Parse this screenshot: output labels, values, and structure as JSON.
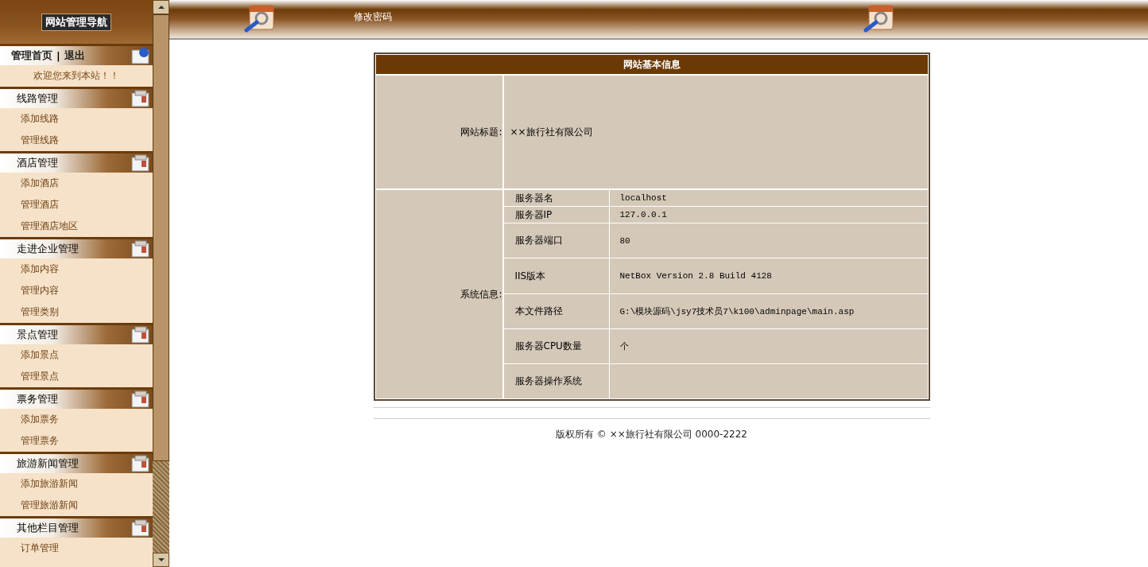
{
  "sidebar": {
    "title": "网站管理导航",
    "top_links": [
      "管理首页",
      "退出"
    ],
    "top_separator": "|",
    "welcome": "欢迎您来到本站！！",
    "sections": [
      {
        "title": "线路管理",
        "items": [
          "添加线路",
          "管理线路"
        ]
      },
      {
        "title": "酒店管理",
        "items": [
          "添加酒店",
          "管理酒店",
          "管理酒店地区"
        ]
      },
      {
        "title": "走进企业管理",
        "items": [
          "添加内容",
          "管理内容",
          "管理类别"
        ]
      },
      {
        "title": "景点管理",
        "items": [
          "添加景点",
          "管理景点"
        ]
      },
      {
        "title": "票务管理",
        "items": [
          "添加票务",
          "管理票务"
        ]
      },
      {
        "title": "旅游新闻管理",
        "items": [
          "添加旅游新闻",
          "管理旅游新闻"
        ]
      },
      {
        "title": "其他栏目管理",
        "items": [
          "订单管理"
        ]
      }
    ]
  },
  "top_bar": {
    "link": "修改密码"
  },
  "info_panel": {
    "title": "网站基本信息",
    "site_title": {
      "label": "网站标题:",
      "value": "××旅行社有限公司"
    },
    "system_info": {
      "label": "系统信息:",
      "rows": [
        {
          "name": "服务器名",
          "value": "localhost"
        },
        {
          "name": "服务器IP",
          "value": "127.0.0.1"
        },
        {
          "name": "服务器端口",
          "value": "80"
        },
        {
          "name": "IIS版本",
          "value": "NetBox Version 2.8 Build 4128"
        },
        {
          "name": "本文件路径",
          "value": "G:\\模块源码\\jsy7技术员7\\k100\\adminpage\\main.asp"
        },
        {
          "name": "服务器CPU数量",
          "value": "个"
        },
        {
          "name": "服务器操作系统"
        }
      ]
    }
  },
  "footer": "版权所有 © ××旅行社有限公司 0000-2222"
}
